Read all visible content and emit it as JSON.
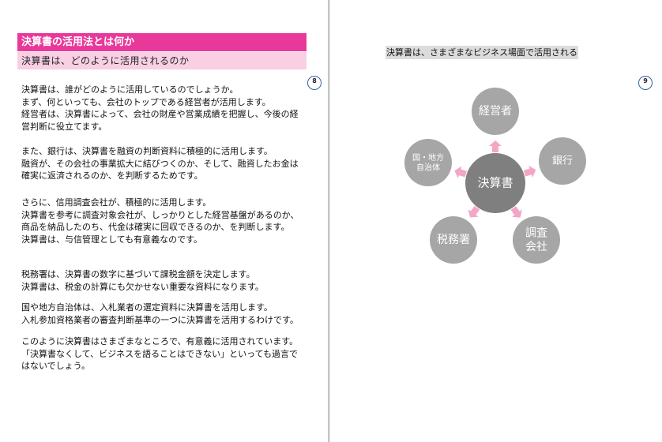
{
  "left_page": {
    "title": "決算書の活用法とは何か",
    "subtitle": "決算書は、どのように活用されるのか",
    "page_number": "8",
    "paragraphs": [
      [
        "決算書は、誰がどのように活用しているのでしょうか。",
        "まず、何といっても、会社のトップである経営者が活用します。",
        "経営者は、決算書によって、会社の財産や営業成績を把握し、今後の経",
        "営判断に役立てます。"
      ],
      [
        "また、銀行は、決算書を融資の判断資料に積極的に活用します。",
        "融資が、その会社の事業拡大に結びつくのか、そして、融資したお金は",
        "確実に返済されるのか、を判断するためです。"
      ],
      [
        "さらに、信用調査会社が、積極的に活用します。",
        "決算書を参考に調査対象会社が、しっかりとした経営基盤があるのか、",
        "商品を納品したのち、代金は確実に回収できるのか、を判断します。",
        "決算書は、与信管理としても有意義なのです。"
      ],
      [
        "税務署は、決算書の数字に基づいて課税金額を決定します。",
        "決算書は、税金の計算にも欠かせない重要な資料になります。"
      ],
      [
        "国や地方自治体は、入札業者の選定資料に決算書を活用します。",
        "入札参加資格業者の審査判断基準の一つに決算書を活用するわけです。"
      ],
      [
        "このように決算書はさまざまなところで、有意義に活用されています。",
        "「決算書なくして、ビジネスを語ることはできない」といっても過言で",
        "はないでしょう。"
      ]
    ]
  },
  "right_page": {
    "caption": "決算書は、さまざまなビジネス場面で活用される",
    "page_number": "9",
    "diagram": {
      "center": "決算書",
      "nodes": [
        {
          "lines": [
            "経営者"
          ]
        },
        {
          "lines": [
            "銀行"
          ]
        },
        {
          "lines": [
            "調査",
            "会社"
          ]
        },
        {
          "lines": [
            "税務署"
          ]
        },
        {
          "lines": [
            "国・地方",
            "自治体"
          ]
        }
      ],
      "colors": {
        "center": "#7f7f7f",
        "node": "#a6a6a6",
        "arrow": "#f4a6c6"
      }
    }
  },
  "colors": {
    "title_bar": "#e8399a",
    "subtitle_bar": "#f9cfe4",
    "caption_bg": "#dcdcdc",
    "page_num_ring": "#3a5fa6"
  }
}
